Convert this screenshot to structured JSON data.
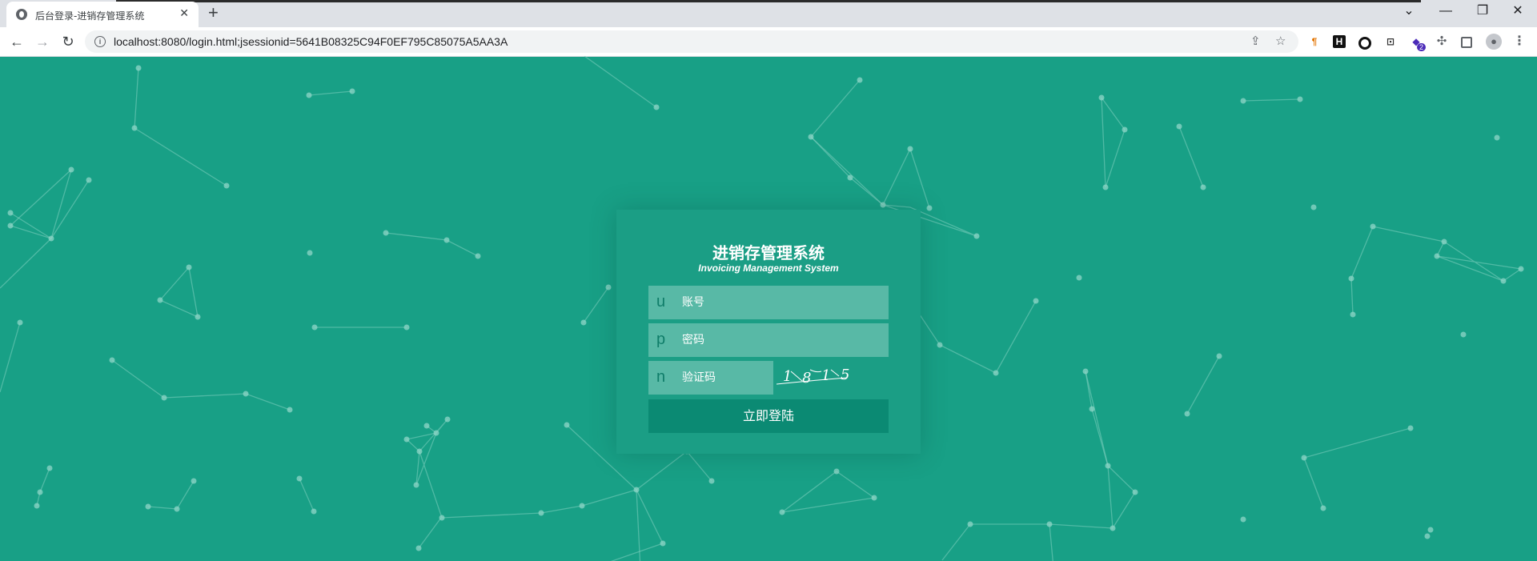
{
  "browser": {
    "tab_title": "后台登录-进销存管理系统",
    "tab_close": "✕",
    "new_tab": "+",
    "url": "localhost:8080/login.html;jsessionid=5641B08325C94F0EF795C85075A5AA3A",
    "window_controls": {
      "dropdown": "⌄",
      "minimize": "—",
      "restore": "❐",
      "close": "✕"
    },
    "nav": {
      "back": "←",
      "forward": "→",
      "reload": "↻"
    },
    "extension_badge": "2"
  },
  "login": {
    "title": "进销存管理系统",
    "subtitle": "Invoicing Management System",
    "username": {
      "icon_letter": "u",
      "placeholder": "账号",
      "value": ""
    },
    "password": {
      "icon_letter": "p",
      "placeholder": "密码",
      "value": ""
    },
    "captcha_field": {
      "icon_letter": "n",
      "placeholder": "验证码",
      "value": ""
    },
    "captcha_chars": [
      "1",
      "8",
      "1",
      "5"
    ],
    "submit_label": "立即登陆"
  },
  "colors": {
    "background": "#18a086",
    "field": "#58b9a6",
    "button": "#0b8a73",
    "network_line": "#7fcfbf"
  },
  "icons": [
    "globe-icon",
    "info-icon",
    "share-icon",
    "star-icon",
    "extensions-icon",
    "sidebar-icon",
    "profile-icon",
    "menu-icon"
  ]
}
